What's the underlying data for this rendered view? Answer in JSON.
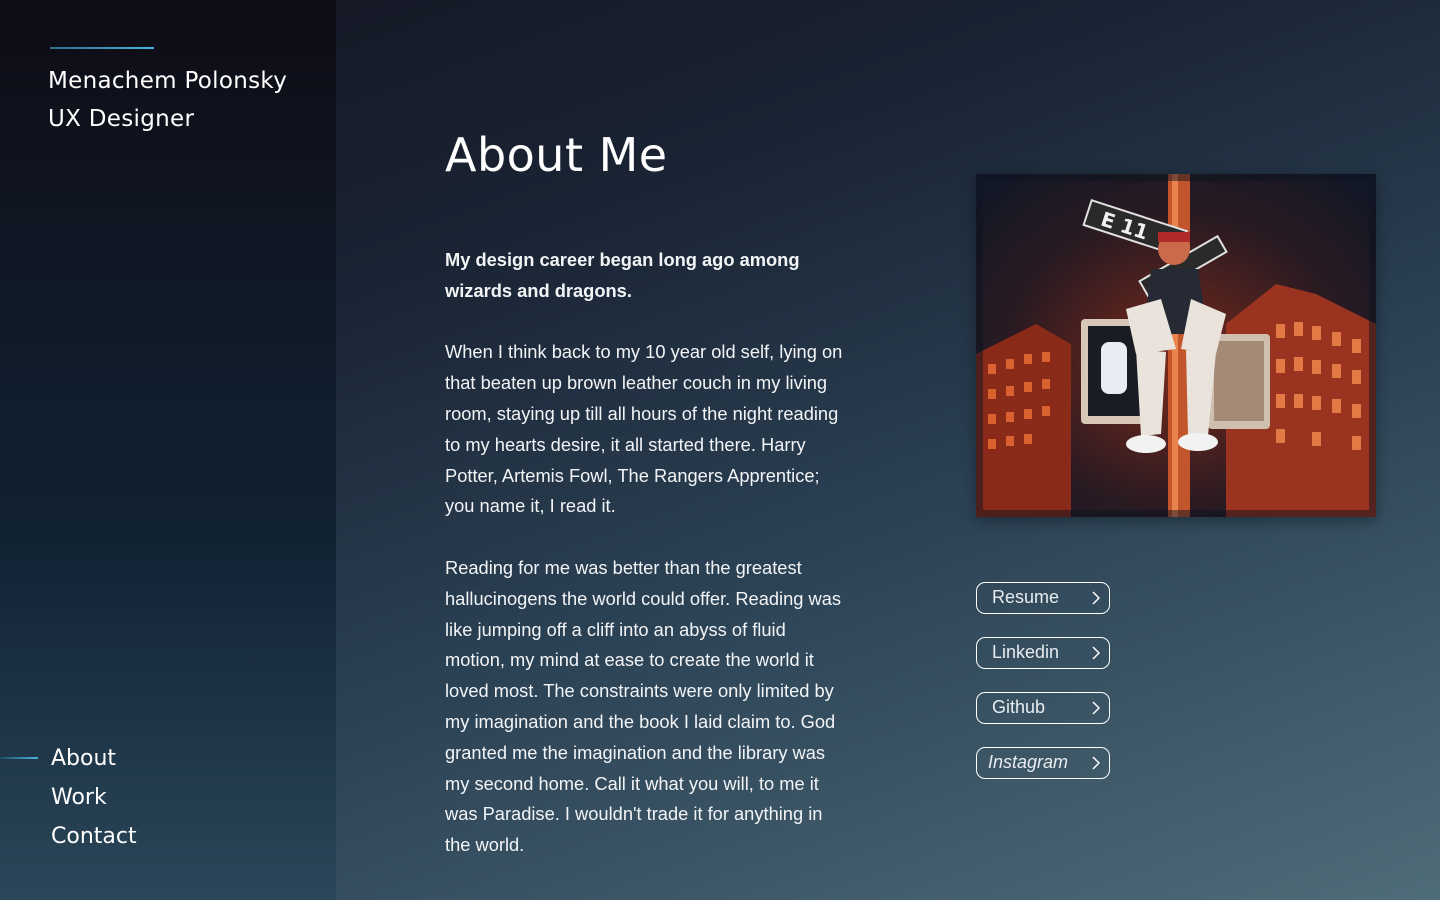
{
  "brand": {
    "name": "Menachem Polonsky",
    "role": "UX Designer"
  },
  "nav": {
    "items": [
      {
        "label": "About",
        "active": true
      },
      {
        "label": "Work",
        "active": false
      },
      {
        "label": "Contact",
        "active": false
      }
    ]
  },
  "main": {
    "title": "About Me",
    "lead": "My design career began long ago among wizards and dragons.",
    "paragraphs": [
      "When I think back to my 10 year old self, lying on that beaten up brown leather couch in my living room, staying up till all hours of the night reading to my hearts desire, it all started there. Harry Potter, Artemis Fowl, The Rangers Apprentice; you name it, I read it.",
      "Reading for me was better than the greatest hallucinogens the world could offer. Reading was like jumping off a cliff into an abyss of fluid motion, my mind at ease to create the world it loved most. The constraints were only limited by my imagination and the book I laid claim to. God granted me the imagination and the library was my second home. Call it what you will, to me it was Paradise. I wouldn't trade it for anything in the world."
    ]
  },
  "photo": {
    "street_sign_text": "E 11"
  },
  "links": [
    {
      "label": "Resume"
    },
    {
      "label": "Linkedin"
    },
    {
      "label": "Github"
    },
    {
      "label": "Instagram"
    }
  ],
  "colors": {
    "accent": "#4ab4dc",
    "text": "#ffffff",
    "sidebar_top": "#0e0c15",
    "page_bottom": "#4f6c79"
  }
}
